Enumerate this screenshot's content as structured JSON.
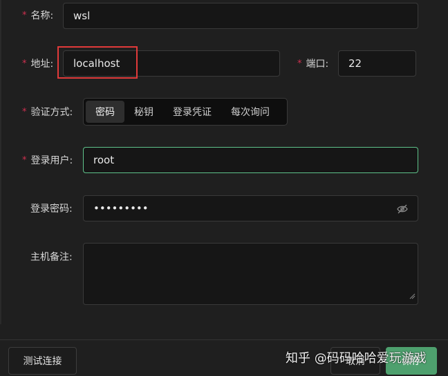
{
  "form": {
    "name": {
      "label": "名称:",
      "value": "wsl"
    },
    "address": {
      "label": "地址:",
      "value": "localhost"
    },
    "port": {
      "label": "端口:",
      "value": "22"
    },
    "auth": {
      "label": "验证方式:",
      "options": [
        "密码",
        "秘钥",
        "登录凭证",
        "每次询问"
      ],
      "selected": "密码"
    },
    "username": {
      "label": "登录用户:",
      "value": "root"
    },
    "password": {
      "label": "登录密码:",
      "value": "•••••••••"
    },
    "notes": {
      "label": "主机备注:",
      "value": ""
    }
  },
  "footer": {
    "test_label": "测试连接",
    "cancel_label": "取消",
    "save_label": "保存"
  },
  "watermark": "知乎 @码码哈哈爱玩游戏",
  "colors": {
    "accent": "#5fc48b",
    "required": "#d03050",
    "highlight": "#e23a3a"
  }
}
